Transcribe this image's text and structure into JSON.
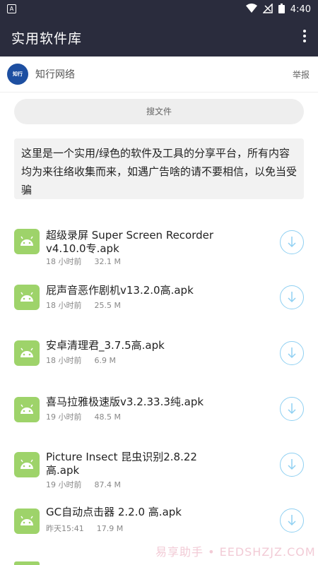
{
  "status": {
    "time": "4:40",
    "battery_icon": "battery-icon",
    "wifi_icon": "wifi-icon",
    "signal_icon": "signal-icon"
  },
  "app": {
    "title": "实用软件库",
    "menu_icon": "more-vert-icon"
  },
  "owner": {
    "avatar_text": "知行",
    "name": "知行网络",
    "report_label": "举报"
  },
  "search": {
    "placeholder": "搜文件"
  },
  "intro": {
    "text": "这里是一个实用/绿色的软件及工具的分享平台，所有内容均为来往络收集而来，如遇广告啥的请不要相信，以免当受骗"
  },
  "files": [
    {
      "name": "超级录屏 Super Screen Recorder v4.10.0专.apk",
      "time": "18 小时前",
      "size": "32.1 M"
    },
    {
      "name": "屁声音恶作剧机v13.2.0高.apk",
      "time": "18 小时前",
      "size": "25.5 M"
    },
    {
      "name": "安卓清理君_3.7.5高.apk",
      "time": "18 小时前",
      "size": "6.9 M"
    },
    {
      "name": "喜马拉雅极速版v3.2.33.3纯.apk",
      "time": "19 小时前",
      "size": "48.5 M"
    },
    {
      "name": "Picture Insect 昆虫识别2.8.22 高.apk",
      "time": "19 小时前",
      "size": "87.4 M"
    },
    {
      "name": "GC自动点击器 2.2.0 高.apk",
      "time": "昨天15:41",
      "size": "17.9 M"
    }
  ],
  "watermark": "易享助手 • EEDSHZJZ.COM",
  "colors": {
    "bar": "#2a2c3d",
    "apk_green": "#9ed36a",
    "download_blue": "#8fd0f2"
  }
}
